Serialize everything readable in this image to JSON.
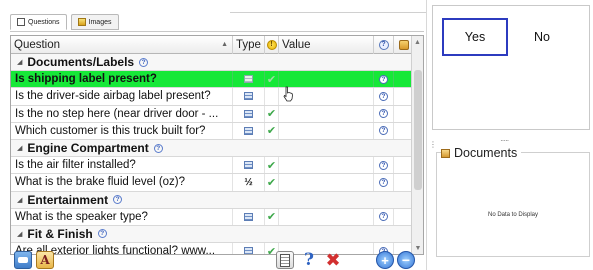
{
  "tabs": [
    {
      "label": "Questions",
      "icon": "form-icon",
      "active": true
    },
    {
      "label": "Images",
      "icon": "image-icon",
      "active": false
    }
  ],
  "grid": {
    "columns": {
      "question": "Question",
      "type": "Type",
      "warning": "!",
      "value": "Value",
      "help": "?",
      "lock": ""
    },
    "rows": [
      {
        "kind": "group",
        "label": "Documents/Labels"
      },
      {
        "kind": "item",
        "question": "Is shipping label present?",
        "type": "list",
        "done": true,
        "value": "",
        "selected": true
      },
      {
        "kind": "item",
        "question": "Is the driver-side airbag label present?",
        "type": "list",
        "done": false,
        "value": ""
      },
      {
        "kind": "item",
        "question": "Is the no step here (near driver door - ...",
        "type": "list",
        "done": true,
        "value": ""
      },
      {
        "kind": "item",
        "question": "Which customer is this truck built for?",
        "type": "list",
        "done": true,
        "value": ""
      },
      {
        "kind": "group",
        "label": "Engine Compartment"
      },
      {
        "kind": "item",
        "question": "Is the air filter installed?",
        "type": "list",
        "done": true,
        "value": ""
      },
      {
        "kind": "item",
        "question": "What is the brake fluid level (oz)?",
        "type": "fraction",
        "type_glyph": "½",
        "done": true,
        "value": ""
      },
      {
        "kind": "group",
        "label": "Entertainment"
      },
      {
        "kind": "item",
        "question": "What is the speaker type?",
        "type": "list",
        "done": true,
        "value": ""
      },
      {
        "kind": "group",
        "label": "Fit & Finish"
      },
      {
        "kind": "item",
        "question": "Are all exterior lights functional? www...",
        "type": "list",
        "done": true,
        "value": ""
      }
    ]
  },
  "answer": {
    "yes_label": "Yes",
    "no_label": "No"
  },
  "documents": {
    "title": "Documents",
    "empty_text": "No Data to Display"
  },
  "colors": {
    "selected_row": "#16e838",
    "yes_border": "#2c3bbf",
    "check": "#3da84a"
  }
}
